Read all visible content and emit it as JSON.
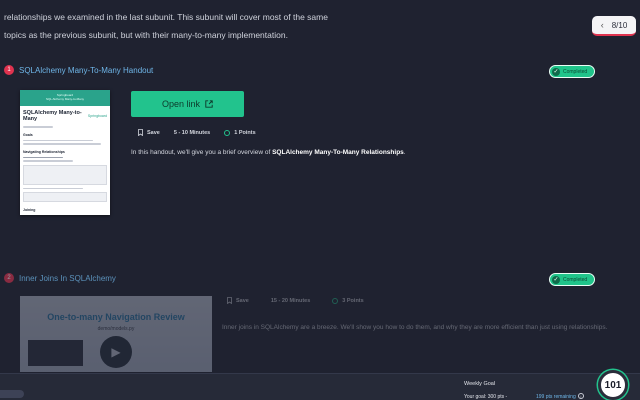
{
  "intro": {
    "line1": "relationships we examined in the last subunit. This subunit will cover most of the same",
    "line2": "topics as the previous subunit, but with their many-to-many implementation."
  },
  "pager": {
    "icon": "chevron-left-icon",
    "text": "8/10"
  },
  "items": [
    {
      "number": "1",
      "title": "SQLAlchemy Many-To-Many Handout",
      "badge": "Completed",
      "thumbnail": {
        "banner_line1": "Springboard",
        "banner_line2": "SQL Alchemy Many-to-Many",
        "title": "SQLAlchemy Many-to-Many",
        "brand": "Springboard",
        "section1": "Goals",
        "section2": "Navigating Relationships",
        "section3": "Joining"
      },
      "button_label": "Open link",
      "save_label": "Save",
      "duration": "5 - 10 Minutes",
      "points": "1 Points",
      "description_prefix": "In this handout, we'll give you a brief overview of ",
      "description_bold": "SQLAlchemy Many-To-Many Relationships",
      "description_suffix": "."
    },
    {
      "number": "2",
      "title": "Inner Joins In SQLAlchemy",
      "badge": "Completed",
      "thumbnail": {
        "video_title": "One-to-many Navigation Review",
        "video_subtitle": "demo/models.py"
      },
      "save_label": "Save",
      "duration": "15 - 20 Minutes",
      "points": "3 Points",
      "description": "Inner joins in SQLAlchemy are a breeze. We'll show you how to do them, and why they are more efficient than just using relationships."
    }
  ],
  "footer": {
    "goal_label": "Weekly Goal",
    "goal_text": "Your goal: 300 pts -",
    "remaining": "199 pts remaining",
    "score": "101"
  },
  "colors": {
    "background": "#1f2230",
    "accent_green": "#22c38d",
    "accent_red": "#e0334f",
    "link_blue": "#6fb6e8"
  }
}
